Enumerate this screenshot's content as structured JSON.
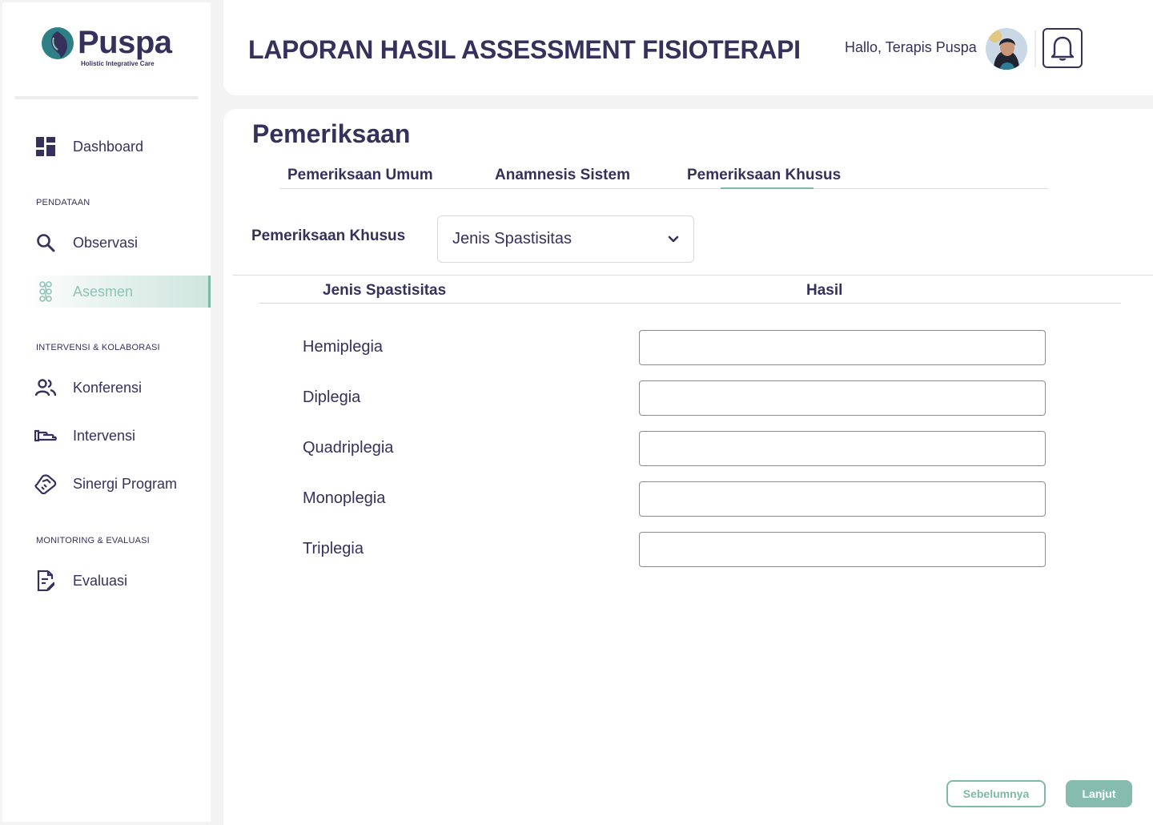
{
  "brand": {
    "name": "Puspa",
    "tagline": "Holistic Integrative Care"
  },
  "header": {
    "title": "LAPORAN HASIL ASSESSMENT FISIOTERAPI",
    "greeting": "Hallo, Terapis Puspa",
    "avatar_icon": "user-avatar",
    "notification_icon": "bell-icon"
  },
  "sidebar": {
    "dashboard": "Dashboard",
    "section_pendataan": "PENDATAAN",
    "observasi": "Observasi",
    "asesmen": "Asesmen",
    "section_intervensi": "INTERVENSI & KOLABORASI",
    "konferensi": "Konferensi",
    "intervensi": "Intervensi",
    "sinergi": "Sinergi Program",
    "section_monitoring": "MONITORING & EVALUASI",
    "evaluasi": "Evaluasi",
    "active_item": "Asesmen"
  },
  "main": {
    "section_title": "Pemeriksaan",
    "tabs": [
      "Pemeriksaan Umum",
      "Anamnesis Sistem",
      "Pemeriksaan Khusus"
    ],
    "active_tab": "Pemeriksaan Khusus",
    "filter_label": "Pemeriksaan Khusus",
    "filter_value": "Jenis Spastisitas",
    "columns": [
      "Jenis Spastisitas",
      "Hasil"
    ],
    "rows": [
      {
        "label": "Hemiplegia",
        "value": ""
      },
      {
        "label": "Diplegia",
        "value": ""
      },
      {
        "label": "Quadriplegia",
        "value": ""
      },
      {
        "label": "Monoplegia",
        "value": ""
      },
      {
        "label": "Triplegia",
        "value": ""
      }
    ],
    "prev_button": "Sebelumnya",
    "next_button": "Lanjut"
  },
  "colors": {
    "primary": "#36315b",
    "accent": "#7fb9a8",
    "logo_teal": "#2f7f86"
  }
}
